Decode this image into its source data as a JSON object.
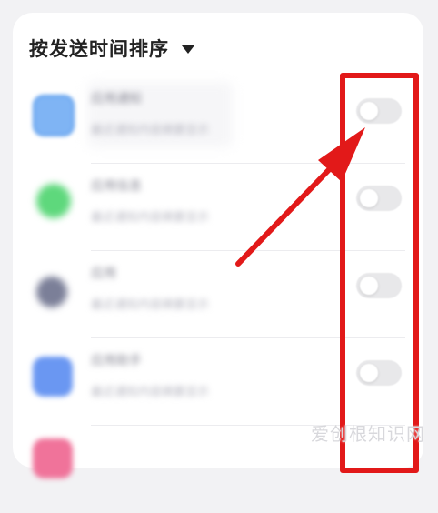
{
  "sort": {
    "label": "按发送时间排序"
  },
  "apps": [
    {
      "name": "应用通知",
      "desc": "最近通知内容摘要显示",
      "toggle": "off"
    },
    {
      "name": "应用信息",
      "desc": "最近通知内容摘要显示",
      "toggle": "off"
    },
    {
      "name": "应用",
      "desc": "最近通知内容摘要显示",
      "toggle": "off"
    },
    {
      "name": "应用助手",
      "desc": "最近通知内容摘要显示",
      "toggle": "off"
    }
  ],
  "watermark": {
    "text": "爱创根知识网"
  },
  "colors": {
    "highlight": "#e21919",
    "toggle_off": "#e8e8ea"
  }
}
